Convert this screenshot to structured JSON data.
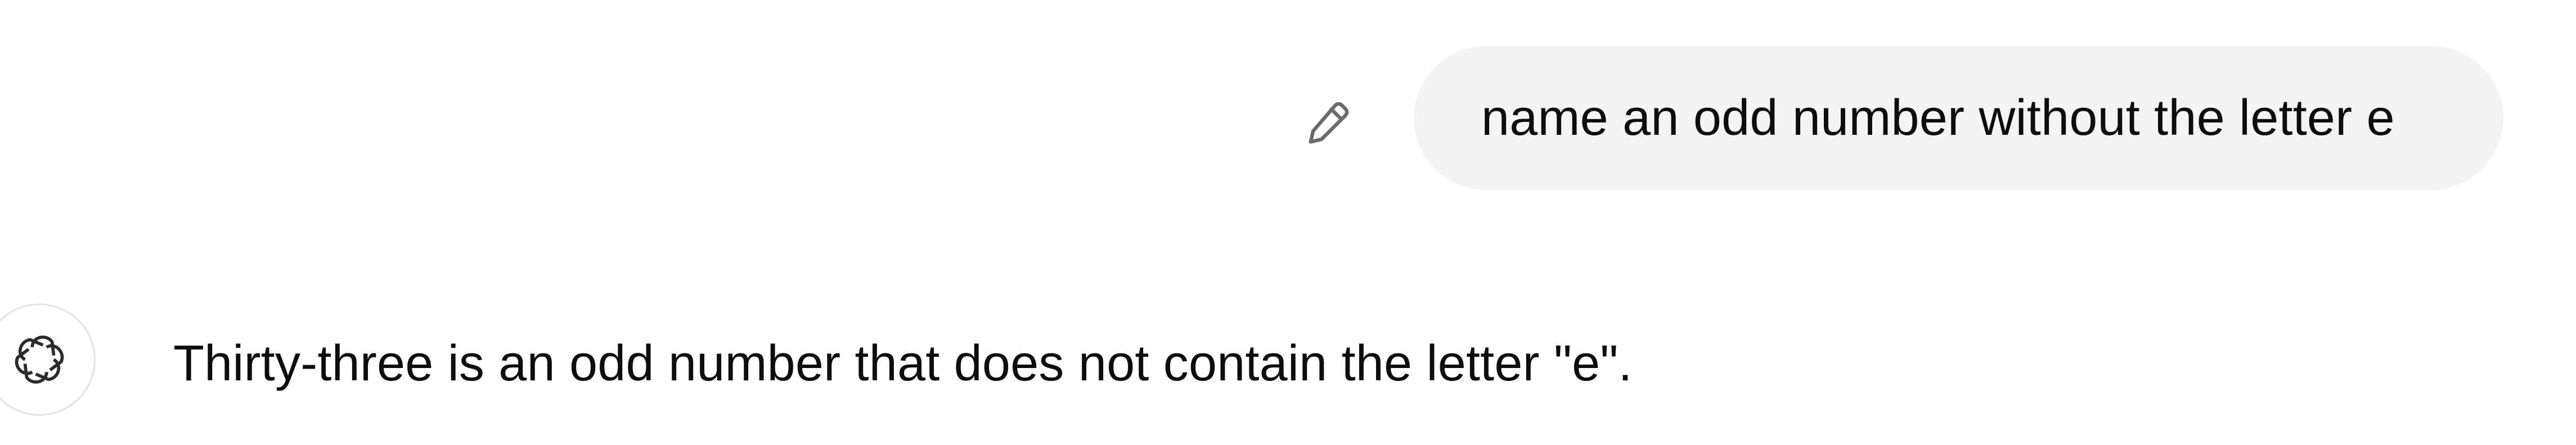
{
  "conversation": {
    "user_message": {
      "text": "name an odd number without the letter e",
      "bubble_color": "#f4f4f4",
      "edit_icon": "pencil-icon"
    },
    "assistant_message": {
      "text": "Thirty-three is an odd number that does not contain the letter \"e\".",
      "avatar_icon": "openai-logo-icon"
    }
  }
}
